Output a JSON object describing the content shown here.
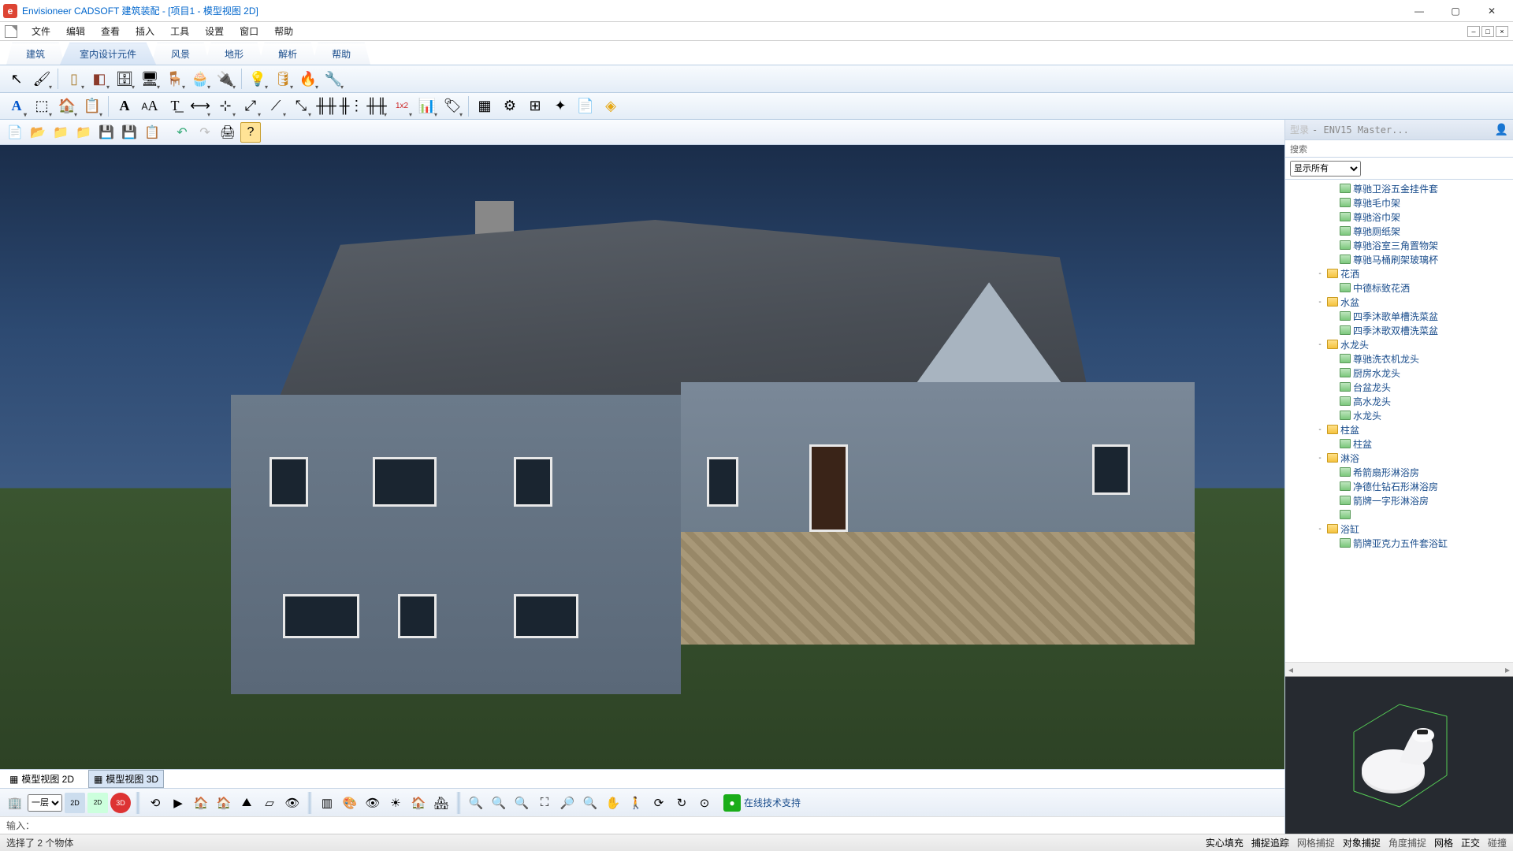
{
  "title": "Envisioneer CADSOFT 建筑装配 - [项目1 - 模型视图 2D]",
  "menu": {
    "file": "文件",
    "edit": "编辑",
    "view": "查看",
    "insert": "插入",
    "tools": "工具",
    "settings": "设置",
    "window": "窗口",
    "help": "帮助"
  },
  "ribbon": {
    "t1": "建筑",
    "t2": "室内设计元件",
    "t3": "风景",
    "t4": "地形",
    "t5": "解析",
    "t6": "帮助"
  },
  "viewtabs": {
    "v2d": "模型视图 2D",
    "v3d": "模型视图 3D"
  },
  "floor_select": "一层",
  "support": "在线技术支持",
  "input_label": "输入：",
  "status_left": "选择了 2 个物体",
  "status": {
    "s1": "实心填充",
    "s2": "捕捉追踪",
    "s3": "网格捕捉",
    "s4": "对象捕捉",
    "s5": "角度捕捉",
    "s6": "网格",
    "s7": "正交",
    "s8": "碰撞"
  },
  "panel": {
    "title1": "型录",
    "title2": "- ENV15 Master...",
    "search": "搜索",
    "filter": "显示所有"
  },
  "tree": [
    {
      "d": 3,
      "t": "leaf",
      "l": "尊驰卫浴五金挂件套"
    },
    {
      "d": 3,
      "t": "leaf",
      "l": "尊驰毛巾架"
    },
    {
      "d": 3,
      "t": "leaf",
      "l": "尊驰浴巾架"
    },
    {
      "d": 3,
      "t": "leaf",
      "l": "尊驰厕纸架"
    },
    {
      "d": 3,
      "t": "leaf",
      "l": "尊驰浴室三角置物架"
    },
    {
      "d": 3,
      "t": "leaf",
      "l": "尊驰马桶刷架玻璃杯"
    },
    {
      "d": 2,
      "t": "fold",
      "tw": "-",
      "l": "花洒"
    },
    {
      "d": 3,
      "t": "leaf",
      "l": "中德标致花洒"
    },
    {
      "d": 2,
      "t": "fold",
      "tw": "-",
      "l": "水盆"
    },
    {
      "d": 3,
      "t": "leaf",
      "l": "四季沐歌单槽洗菜盆"
    },
    {
      "d": 3,
      "t": "leaf",
      "l": "四季沐歌双槽洗菜盆"
    },
    {
      "d": 2,
      "t": "fold",
      "tw": "-",
      "l": "水龙头"
    },
    {
      "d": 3,
      "t": "leaf",
      "l": "尊驰洗衣机龙头"
    },
    {
      "d": 3,
      "t": "leaf",
      "l": "厨房水龙头"
    },
    {
      "d": 3,
      "t": "leaf",
      "l": "台盆龙头"
    },
    {
      "d": 3,
      "t": "leaf",
      "l": "高水龙头"
    },
    {
      "d": 3,
      "t": "leaf",
      "l": "水龙头"
    },
    {
      "d": 2,
      "t": "fold",
      "tw": "-",
      "l": "柱盆"
    },
    {
      "d": 3,
      "t": "leaf",
      "l": "柱盆"
    },
    {
      "d": 2,
      "t": "fold",
      "tw": "-",
      "l": "淋浴"
    },
    {
      "d": 3,
      "t": "leaf",
      "l": "希箭扇形淋浴房"
    },
    {
      "d": 3,
      "t": "leaf",
      "l": "净德仕钻石形淋浴房"
    },
    {
      "d": 3,
      "t": "leaf",
      "l": "箭牌一字形淋浴房"
    },
    {
      "d": 3,
      "t": "leaf",
      "l": ""
    },
    {
      "d": 2,
      "t": "fold",
      "tw": "-",
      "l": "浴缸"
    },
    {
      "d": 3,
      "t": "leaf",
      "l": "箭牌亚克力五件套浴缸"
    }
  ]
}
